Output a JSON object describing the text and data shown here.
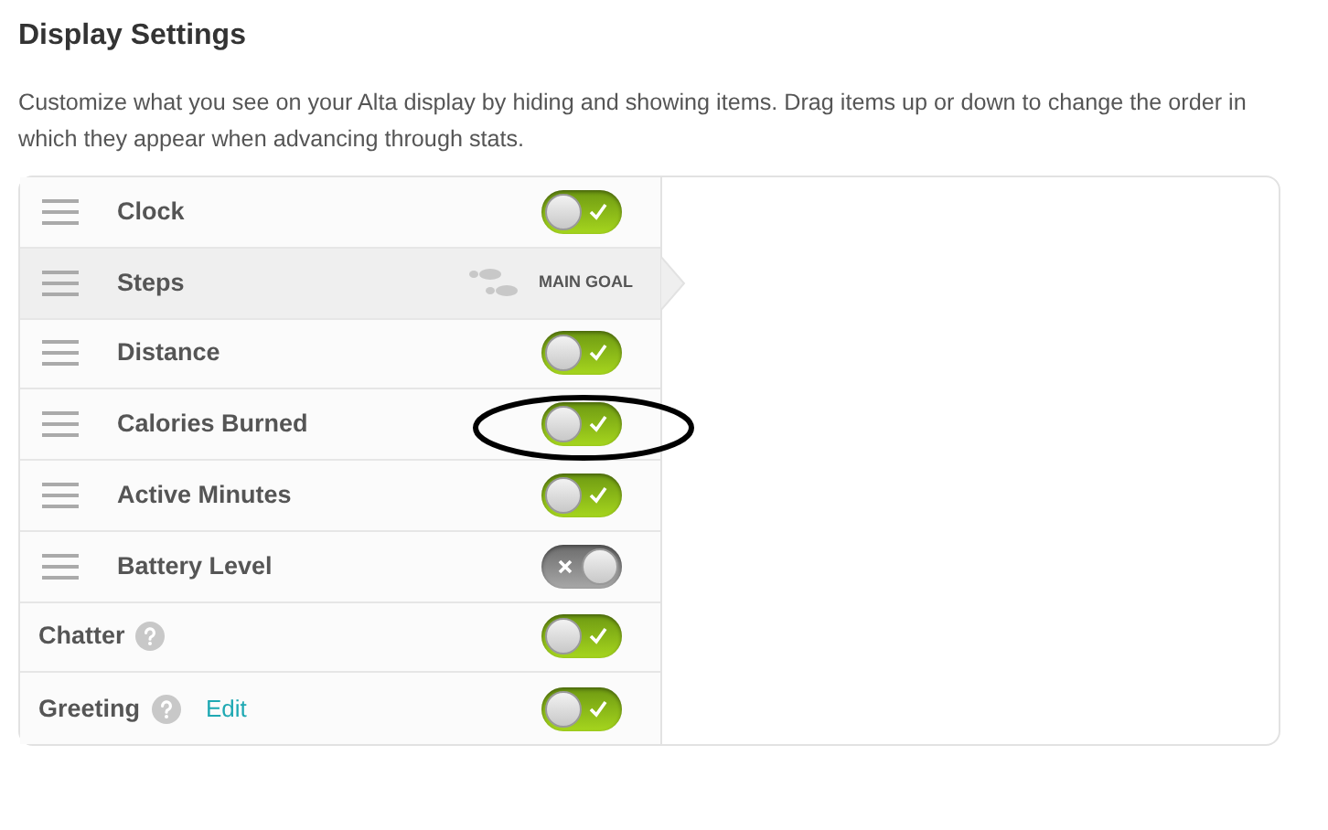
{
  "title": "Display Settings",
  "description": "Customize what you see on your Alta display by hiding and showing items. Drag items up or down to change the order in which they appear when advancing through stats.",
  "rows": [
    {
      "kind": "toggle",
      "label": "Clock",
      "draggable": true,
      "selected": false,
      "on": true,
      "circled": false
    },
    {
      "kind": "goal",
      "label": "Steps",
      "draggable": true,
      "selected": true,
      "badge": "MAIN GOAL"
    },
    {
      "kind": "toggle",
      "label": "Distance",
      "draggable": true,
      "selected": false,
      "on": true,
      "circled": false
    },
    {
      "kind": "toggle",
      "label": "Calories Burned",
      "draggable": true,
      "selected": false,
      "on": true,
      "circled": true
    },
    {
      "kind": "toggle",
      "label": "Active Minutes",
      "draggable": true,
      "selected": false,
      "on": true,
      "circled": false
    },
    {
      "kind": "toggle",
      "label": "Battery Level",
      "draggable": true,
      "selected": false,
      "on": false,
      "circled": false
    },
    {
      "kind": "toggle",
      "label": "Chatter",
      "draggable": false,
      "help": true,
      "selected": false,
      "on": true,
      "circled": false
    },
    {
      "kind": "toggle",
      "label": "Greeting",
      "draggable": false,
      "help": true,
      "link": "Edit",
      "selected": false,
      "on": true,
      "circled": false
    }
  ]
}
